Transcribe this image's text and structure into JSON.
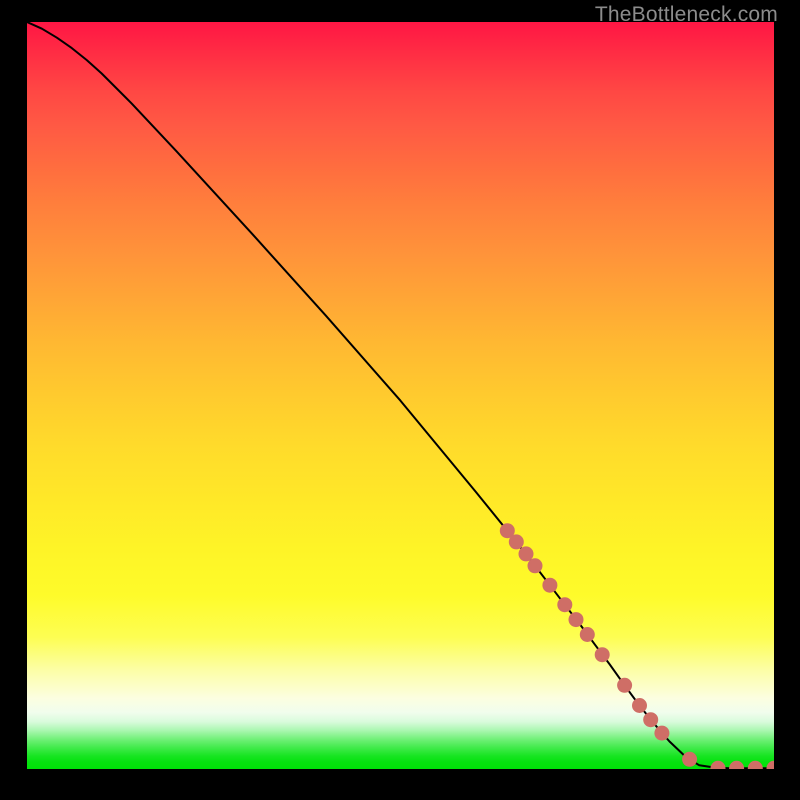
{
  "watermark": "TheBottleneck.com",
  "chart_data": {
    "type": "line",
    "title": "",
    "xlabel": "",
    "ylabel": "",
    "xlim": [
      0,
      100
    ],
    "ylim": [
      0,
      100
    ],
    "grid": false,
    "series": [
      {
        "name": "curve",
        "style": "solid-black",
        "x": [
          0.0,
          2.0,
          4.0,
          6.0,
          8.0,
          10.0,
          14.0,
          20.0,
          30.0,
          40.0,
          50.0,
          60.0,
          64.3,
          68.0,
          70.0,
          72.0,
          74.0,
          76.0,
          78.0,
          80.0,
          82.0,
          84.0,
          86.0,
          88.0,
          88.7,
          90.0,
          92.0,
          94.0,
          95.0,
          97.5,
          100.0
        ],
        "y": [
          100.0,
          99.1,
          97.9,
          96.5,
          94.9,
          93.1,
          89.1,
          82.7,
          71.8,
          60.7,
          49.3,
          37.2,
          31.9,
          27.2,
          24.6,
          22.0,
          19.4,
          16.7,
          14.0,
          11.2,
          8.5,
          6.0,
          3.7,
          1.8,
          1.3,
          0.5,
          0.2,
          0.1,
          0.1,
          0.1,
          0.1
        ]
      },
      {
        "name": "markers",
        "style": "dot-coral",
        "x": [
          64.3,
          65.5,
          66.8,
          68.0,
          70.0,
          72.0,
          73.5,
          75.0,
          77.0,
          80.0,
          82.0,
          83.5,
          85.0,
          88.7,
          92.5,
          95.0,
          97.5,
          100.0
        ],
        "y": [
          31.9,
          30.4,
          28.8,
          27.2,
          24.6,
          22.0,
          20.0,
          18.0,
          15.3,
          11.2,
          8.5,
          6.6,
          4.8,
          1.3,
          0.1,
          0.1,
          0.1,
          0.1
        ]
      }
    ],
    "annotations": []
  },
  "colors": {
    "curve": "#000000",
    "marker": "#cf6e66",
    "background_top": "#ff1644",
    "background_bottom": "#00e108"
  }
}
